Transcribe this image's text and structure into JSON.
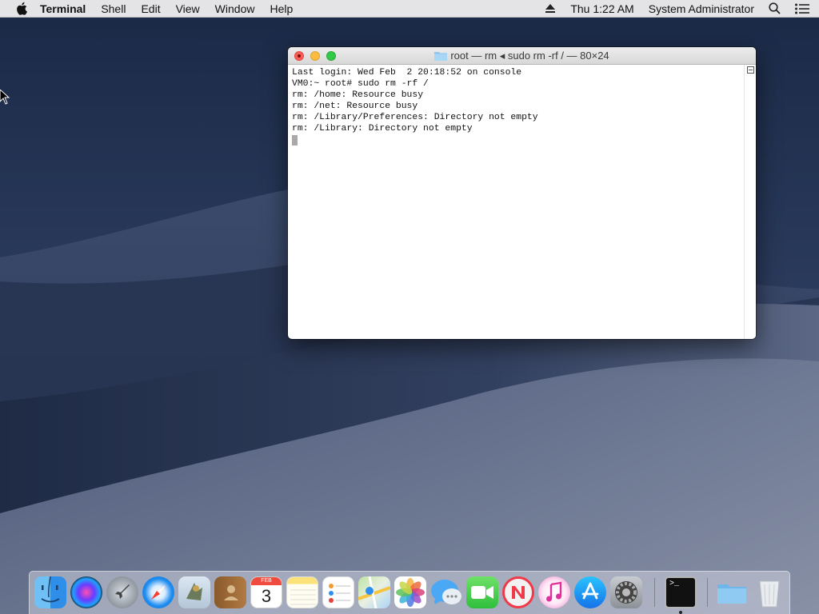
{
  "menubar": {
    "app_name": "Terminal",
    "menus": [
      "Shell",
      "Edit",
      "View",
      "Window",
      "Help"
    ],
    "clock": "Thu 1:22 AM",
    "user": "System Administrator"
  },
  "terminal": {
    "title": "root — rm ◂ sudo rm -rf / — 80×24",
    "lines": [
      "Last login: Wed Feb  2 20:18:52 on console",
      "VM0:~ root# sudo rm -rf /",
      "rm: /home: Resource busy",
      "rm: /net: Resource busy",
      "rm: /Library/Preferences: Directory not empty",
      "rm: /Library: Directory not empty"
    ]
  },
  "dock": {
    "calendar_month": "FEB",
    "calendar_day": "3",
    "terminal_prompt": ">_",
    "items": [
      "finder-icon",
      "siri-icon",
      "launchpad-icon",
      "safari-icon",
      "mail-icon",
      "contacts-icon",
      "calendar-icon",
      "notes-icon",
      "reminders-icon",
      "maps-icon",
      "photos-icon",
      "messages-icon",
      "facetime-icon",
      "news-icon",
      "itunes-icon",
      "app-store-icon",
      "system-preferences-icon",
      "terminal-icon",
      "downloads-folder-icon",
      "trash-icon"
    ]
  },
  "colors": {
    "close": "#fc605b",
    "minimize": "#fdbc40",
    "maximize": "#34c84a"
  }
}
